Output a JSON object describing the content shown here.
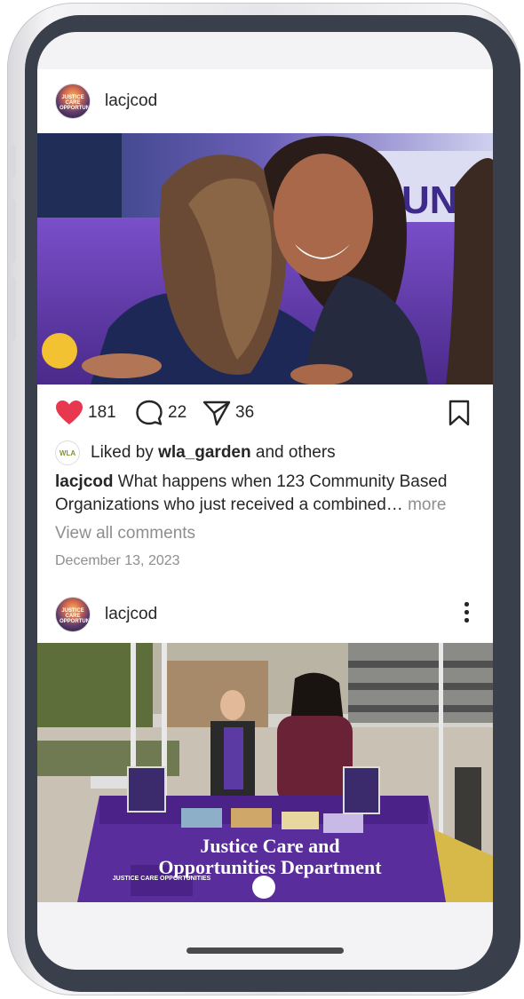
{
  "post1": {
    "username": "lacjcod",
    "avatar_text": "JUSTICE CARE OPPORTUNITIES",
    "likes": "181",
    "comments": "22",
    "shares": "36",
    "liked_by_prefix": "Liked by",
    "liked_by_user": "wla_garden",
    "liked_by_suffix": "and others",
    "liked_avatar_text": "WLA",
    "caption_user": "lacjcod",
    "caption_text": "What happens when 123 Community Based Organizations who just received a combined…",
    "more": "more",
    "view_comments": "View all comments",
    "date": "December 13, 2023",
    "photo_banner_text": "UNIT"
  },
  "post2": {
    "username": "lacjcod",
    "avatar_text": "JUSTICE CARE OPPORTUNITIES",
    "tablecloth_line1": "Justice Care and",
    "tablecloth_line2": "Opportunities Department",
    "tablecloth_logo": "JUSTICE CARE OPPORTUNITIES"
  },
  "colors": {
    "heart": "#e8384f",
    "text": "#262626",
    "muted": "#8e8e8e",
    "purple": "#5a2d9c"
  },
  "icons": [
    "heart-icon",
    "comment-icon",
    "share-icon",
    "bookmark-icon",
    "more-dots-icon"
  ]
}
